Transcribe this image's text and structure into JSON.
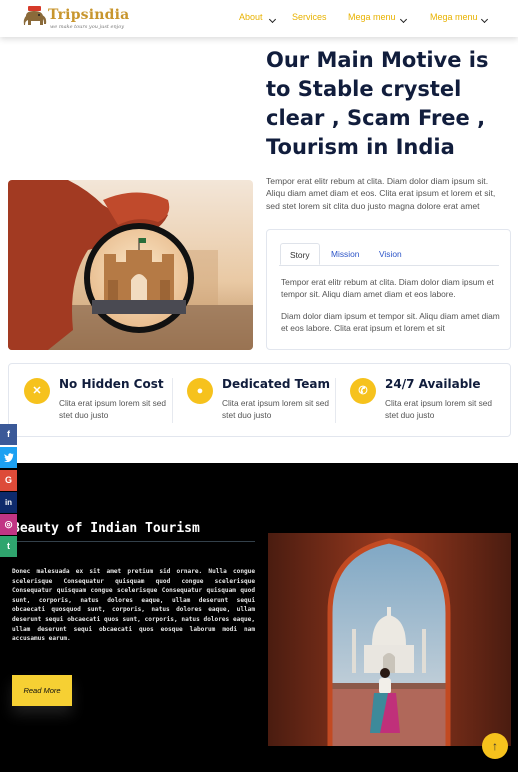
{
  "brand": {
    "name": "Tripsindia",
    "tagline": "we make tours you just enjoy"
  },
  "nav": {
    "items": [
      {
        "label": "About",
        "has_caret": true
      },
      {
        "label": "Services",
        "has_caret": false
      },
      {
        "label": "Mega menu",
        "has_caret": true
      },
      {
        "label": "Mega menu",
        "has_caret": true
      }
    ]
  },
  "motive": {
    "title": "Our Main Motive is to Stable crystel clear , Scam Free , Tourism in India",
    "text": "Tempor erat elitr rebum at clita. Diam dolor diam ipsum sit. Aliqu diam amet diam et eos. Clita erat ipsum et lorem et sit, sed stet lorem sit clita duo justo magna dolore erat amet"
  },
  "tabs": {
    "items": [
      "Story",
      "Mission",
      "Vision"
    ],
    "active": "Story",
    "paragraph1": "Tempor erat elitr rebum at clita. Diam dolor diam ipsum et tempor sit. Aliqu diam amet diam et eos labore.",
    "paragraph2": "Diam dolor diam ipsum et tempor sit. Aliqu diam amet diam et eos labore. Clita erat ipsum et lorem et sit"
  },
  "features": [
    {
      "icon": "times-icon",
      "glyph": "✕",
      "title": "No Hidden Cost",
      "text": "Clita erat ipsum lorem sit sed stet duo justo"
    },
    {
      "icon": "users-icon",
      "glyph": "●",
      "title": "Dedicated Team",
      "text": "Clita erat ipsum lorem sit sed stet duo justo"
    },
    {
      "icon": "phone-icon",
      "glyph": "✆",
      "title": "24/7 Available",
      "text": "Clita erat ipsum lorem sit sed stet duo justo"
    }
  ],
  "social": [
    {
      "name": "facebook-icon",
      "glyph": "f",
      "color": "#3b5998"
    },
    {
      "name": "twitter-icon",
      "glyph": "🐦",
      "color": "#1da1f2"
    },
    {
      "name": "google-icon",
      "glyph": "G",
      "color": "#dd4b39"
    },
    {
      "name": "linkedin-icon",
      "glyph": "in",
      "color": "#0e2a6b"
    },
    {
      "name": "instagram-icon",
      "glyph": "◎",
      "color": "#c13584"
    },
    {
      "name": "tumblr-icon",
      "glyph": "t",
      "color": "#2fa56e"
    }
  ],
  "tourism": {
    "title": "Beauty of Indian Tourism",
    "text": "Donec malesuada ex sit amet pretium sid ornare. Nulla congue scelerisque Consequatur quisquam quod congue scelerisque Consequatur quisquam congue scelerisque Consequatur quisquam quod sunt, corporis, natus dolores eaque, ullam deserunt sequi obcaecati quosquod sunt, corporis, natus dolores eaque, ullam deserunt sequi obcaecati quos sunt, corporis, natus dolores eaque, ullam deserunt sequi obcaecati quos eosque laborum modi nam accusamus earum.",
    "button_label": "Read More"
  },
  "back_to_top": "↑",
  "colors": {
    "accent": "#f6c21d",
    "heading": "#111d3c",
    "link": "#2d55c8",
    "dark_bg": "#000000"
  }
}
